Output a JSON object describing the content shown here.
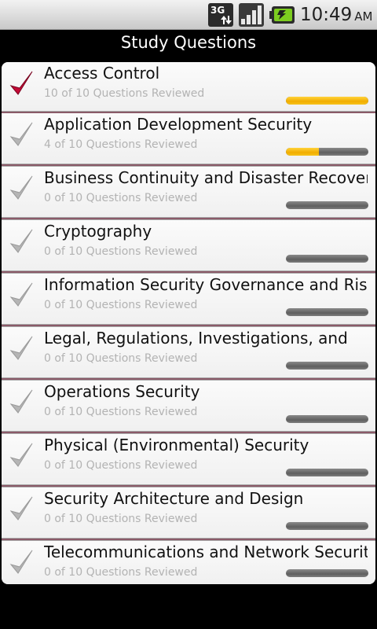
{
  "status_bar": {
    "network": "3G",
    "network_icon": "3g-data-icon",
    "signal_icon": "signal-strength-icon",
    "battery_icon": "battery-charging-icon",
    "time": "10:49",
    "ampm": "AM"
  },
  "header": {
    "title": "Study Questions"
  },
  "colors": {
    "checked": "#c40a36",
    "unchecked": "#b5b5b5",
    "progress_fill": "#f5b800",
    "progress_track": "#6e6e6e"
  },
  "topics": [
    {
      "title": "Access Control",
      "subtitle": "10 of 10 Questions Reviewed",
      "reviewed": 10,
      "total": 10,
      "checked": true
    },
    {
      "title": "Application Development Security",
      "subtitle": "4 of 10 Questions Reviewed",
      "reviewed": 4,
      "total": 10,
      "checked": false
    },
    {
      "title": "Business Continuity and Disaster Recovery",
      "subtitle": "0 of 10 Questions Reviewed",
      "reviewed": 0,
      "total": 10,
      "checked": false
    },
    {
      "title": "Cryptography",
      "subtitle": "0 of 10 Questions Reviewed",
      "reviewed": 0,
      "total": 10,
      "checked": false
    },
    {
      "title": "Information Security Governance and Risk",
      "subtitle": "0 of 10 Questions Reviewed",
      "reviewed": 0,
      "total": 10,
      "checked": false
    },
    {
      "title": "Legal, Regulations, Investigations, and",
      "subtitle": "0 of 10 Questions Reviewed",
      "reviewed": 0,
      "total": 10,
      "checked": false
    },
    {
      "title": "Operations Security",
      "subtitle": "0 of 10 Questions Reviewed",
      "reviewed": 0,
      "total": 10,
      "checked": false
    },
    {
      "title": "Physical (Environmental) Security",
      "subtitle": "0 of 10 Questions Reviewed",
      "reviewed": 0,
      "total": 10,
      "checked": false
    },
    {
      "title": "Security Architecture and Design",
      "subtitle": "0 of 10 Questions Reviewed",
      "reviewed": 0,
      "total": 10,
      "checked": false
    },
    {
      "title": "Telecommunications and Network Security",
      "subtitle": "0 of 10 Questions Reviewed",
      "reviewed": 0,
      "total": 10,
      "checked": false
    }
  ]
}
